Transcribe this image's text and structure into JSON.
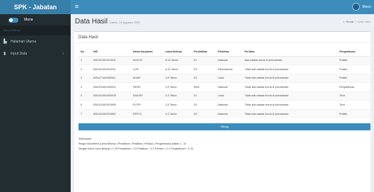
{
  "brand": {
    "title": "SPK - Jabatan"
  },
  "topbar": {
    "menu_icon": "≡",
    "user_name": "Mono"
  },
  "sidebar": {
    "user_label": "Mona",
    "header": "Menu Utama",
    "items": [
      {
        "label": "Halaman Utama",
        "icon": "dashboard-icon"
      },
      {
        "label": "Input Data",
        "icon": "bar-chart-icon"
      }
    ]
  },
  "page": {
    "title": "Data Hasil",
    "subtitle": "Kamis, 15 Agustus 2021",
    "breadcrumb": {
      "home": "Home",
      "current": "Data Hasil"
    }
  },
  "box": {
    "title": "Data Hasil"
  },
  "table": {
    "headers": [
      "No",
      "NIK",
      "Nama Karyawan",
      "Lama Bekerja",
      "Pendidikan",
      "Pelatihan",
      "Perilaku",
      "Pengetahuan"
    ],
    "rows": [
      [
        "1",
        "6301021601910011",
        "MUFLIS",
        "6-10 Tahun",
        "S1",
        "Nasional",
        "Ada catatan buruk di perusahaan",
        "Praktik"
      ],
      [
        "2",
        "6301031601910011",
        "LUSI",
        "6-10 Tahun",
        "D3",
        "Internasional",
        "Tidak ada catatan buruk di perusahaan",
        "Praktik"
      ],
      [
        "3",
        "6301171601890011",
        "ADAM",
        "3-5 Tahun",
        "D3",
        "Lokal",
        "Tidak ada catatan buruk di perusahaan",
        "Praktik"
      ],
      [
        "4",
        "6301031601930012",
        "FAHRI",
        "3-5 Tahun",
        "SMA",
        "Nasional",
        "Tidak ada catatan buruk di perusahaan",
        "Pengetahuan"
      ],
      [
        "5",
        "6301031601920678",
        "SAKORI",
        "0-3 Tahun",
        "S1",
        "Lokal",
        "Tidak ada catatan buruk di perusahaan",
        "Teori"
      ],
      [
        "6",
        "6301031601910690",
        "PUTRI",
        "3-5 Tahun",
        "D3",
        "Nasional",
        "Tidak ada catatan buruk di perusahaan",
        "Teori"
      ],
      [
        "7",
        "6301031601910691",
        "RESTU",
        "0-3 Tahun",
        "D3",
        "Nasional",
        "Tidak ada catatan buruk di perusahaan",
        "Praktik"
      ]
    ]
  },
  "hitung_button": "Hitung",
  "notes": {
    "heading": "Keterangan:",
    "line1": "Range nilai kriteria (Lama Bekerja | Pendidikan | Pelatihan | Perilaku | Pengetahuan) adalah 1 - 10",
    "line2": "Dengan bobot Lama Bekerja = 0.25 Pendidikan = 0.3 Pelatihan = 0.2 Perilaku = 0.1 Pengetahuan = 0.15"
  }
}
